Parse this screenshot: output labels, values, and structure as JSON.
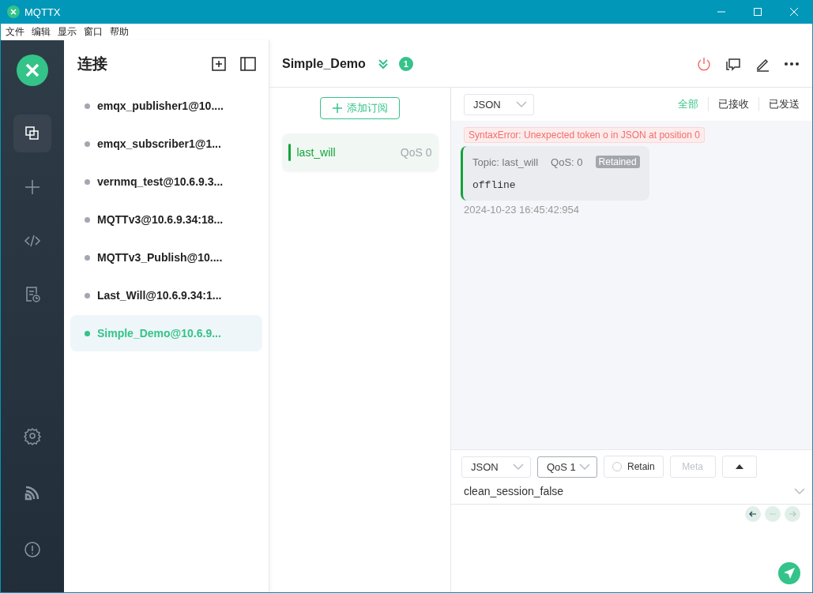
{
  "window": {
    "title": "MQTTX"
  },
  "menu": [
    "文件",
    "编辑",
    "显示",
    "窗口",
    "帮助"
  ],
  "nav": [
    {
      "selected": true
    },
    {
      "selected": false
    },
    {
      "selected": false
    },
    {
      "selected": false
    }
  ],
  "nav_bottom": [
    {
      "selected": false
    },
    {
      "selected": false
    },
    {
      "selected": false
    }
  ],
  "connections": {
    "title": "连接",
    "items": [
      {
        "name": "emqx_publisher1@10....",
        "connected": false,
        "selected": false
      },
      {
        "name": "emqx_subscriber1@1...",
        "connected": false,
        "selected": false
      },
      {
        "name": "vernmq_test@10.6.9.3...",
        "connected": false,
        "selected": false
      },
      {
        "name": "MQTTv3@10.6.9.34:18...",
        "connected": false,
        "selected": false
      },
      {
        "name": "MQTTv3_Publish@10....",
        "connected": false,
        "selected": false
      },
      {
        "name": "Last_Will@10.6.9.34:1...",
        "connected": false,
        "selected": false
      },
      {
        "name": "Simple_Demo@10.6.9...",
        "connected": true,
        "selected": true
      }
    ]
  },
  "header": {
    "title": "Simple_Demo",
    "badge": "1"
  },
  "subscriptions": {
    "add_label": "添加订阅",
    "items": [
      {
        "topic": "last_will",
        "qos": "QoS 0",
        "color": "#14a33c"
      }
    ]
  },
  "messages": {
    "format": "JSON",
    "filters": [
      {
        "label": "全部",
        "selected": true
      },
      {
        "label": "已接收",
        "selected": false
      },
      {
        "label": "已发送",
        "selected": false
      }
    ],
    "error": "SyntaxError: Unexpected token o in JSON at position 0",
    "items": [
      {
        "topic": "Topic: last_will",
        "qos": "QoS: 0",
        "retained": true,
        "badge": "Retained",
        "payload": "offline",
        "time": "2024-10-23 16:45:42:954"
      }
    ]
  },
  "publish": {
    "format": "JSON",
    "qos": "QoS 1",
    "retain": {
      "label": "Retain",
      "checked": false
    },
    "meta": "Meta",
    "topic": "clean_session_false"
  }
}
